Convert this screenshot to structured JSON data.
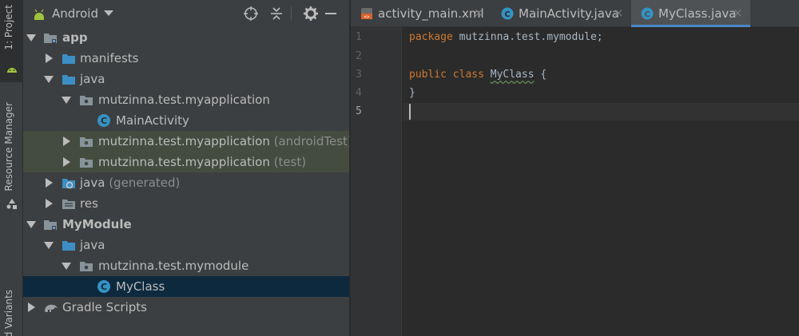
{
  "side_strip": {
    "project_tab": "1: Project",
    "resource_manager_tab": "Resource Manager",
    "build_variants_tab": "d Variants"
  },
  "project_panel": {
    "view_label": "Android",
    "tree": [
      {
        "label": "app",
        "suffix": "",
        "bold": true
      },
      {
        "label": "manifests",
        "suffix": ""
      },
      {
        "label": "java",
        "suffix": ""
      },
      {
        "label": "mutzinna.test.myapplication",
        "suffix": ""
      },
      {
        "label": "MainActivity",
        "suffix": ""
      },
      {
        "label": "mutzinna.test.myapplication",
        "suffix": " (androidTest)"
      },
      {
        "label": "mutzinna.test.myapplication",
        "suffix": " (test)"
      },
      {
        "label": "java",
        "suffix": " (generated)"
      },
      {
        "label": "res",
        "suffix": ""
      },
      {
        "label": "MyModule",
        "suffix": "",
        "bold": true
      },
      {
        "label": "java",
        "suffix": ""
      },
      {
        "label": "mutzinna.test.mymodule",
        "suffix": ""
      },
      {
        "label": "MyClass",
        "suffix": ""
      },
      {
        "label": "Gradle Scripts",
        "suffix": ""
      }
    ]
  },
  "editor": {
    "tabs": [
      {
        "label": "activity_main.xml",
        "close": "×",
        "active": false
      },
      {
        "label": "MainActivity.java",
        "close": "×",
        "active": false
      },
      {
        "label": "MyClass.java",
        "close": "×",
        "active": true
      }
    ],
    "line_numbers": [
      "1",
      "2",
      "3",
      "4",
      "5"
    ],
    "code": {
      "line1_kw": "package",
      "line1_rest": " mutzinna.test.mymodule;",
      "line3_kw": "public class",
      "line3_name": "MyClass",
      "line3_rest": " {",
      "line4": "}"
    }
  },
  "colors": {
    "panel_bg": "#3c3f41",
    "editor_bg": "#2b2b2b",
    "keyword": "#cc7832",
    "selection": "#0d293e",
    "tab_underline": "#4a88c7"
  }
}
